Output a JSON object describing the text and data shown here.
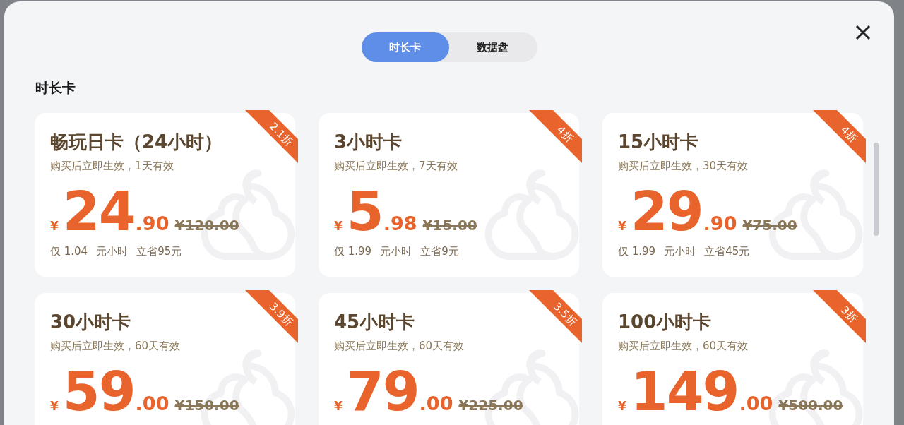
{
  "tabs": [
    {
      "label": "时长卡",
      "selected": true
    },
    {
      "label": "数据盘",
      "selected": false
    }
  ],
  "section_title": "时长卡",
  "cards": [
    {
      "title": "畅玩日卡（24小时）",
      "validity": "购买后立即生效，1天有效",
      "currency": "¥",
      "price_integer": "24",
      "price_decimal": ".90",
      "original_price": "¥120.00",
      "discount": "2.1折",
      "per_hour": "仅 1.04",
      "per_hour_unit": "元小时",
      "savings": "立省95元"
    },
    {
      "title": "3小时卡",
      "validity": "购买后立即生效，7天有效",
      "currency": "¥",
      "price_integer": "5",
      "price_decimal": ".98",
      "original_price": "¥15.00",
      "discount": "4折",
      "per_hour": "仅 1.99",
      "per_hour_unit": "元小时",
      "savings": "立省9元"
    },
    {
      "title": "15小时卡",
      "validity": "购买后立即生效，30天有效",
      "currency": "¥",
      "price_integer": "29",
      "price_decimal": ".90",
      "original_price": "¥75.00",
      "discount": "4折",
      "per_hour": "仅 1.99",
      "per_hour_unit": "元小时",
      "savings": "立省45元"
    },
    {
      "title": "30小时卡",
      "validity": "购买后立即生效，60天有效",
      "currency": "¥",
      "price_integer": "59",
      "price_decimal": ".00",
      "original_price": "¥150.00",
      "discount": "3.9折"
    },
    {
      "title": "45小时卡",
      "validity": "购买后立即生效，60天有效",
      "currency": "¥",
      "price_integer": "79",
      "price_decimal": ".00",
      "original_price": "¥225.00",
      "discount": "3.5折"
    },
    {
      "title": "100小时卡",
      "validity": "购买后立即生效，60天有效",
      "currency": "¥",
      "price_integer": "149",
      "price_decimal": ".00",
      "original_price": "¥500.00",
      "discount": "3折"
    }
  ]
}
